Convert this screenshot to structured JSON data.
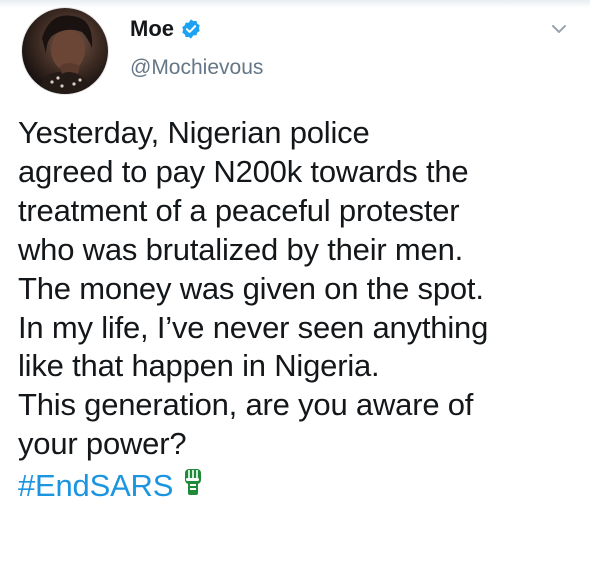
{
  "author": {
    "name": "Moe",
    "handle": "@Mochievous",
    "verified": true
  },
  "tweet": {
    "lines": [
      "Yesterday, Nigerian police",
      "agreed to pay N200k towards the",
      "treatment of a peaceful protester",
      "who was brutalized by their men.",
      "The money was given on the spot.",
      "In my life, I’ve never seen anything",
      "like that happen in Nigeria.",
      "This generation, are you aware of",
      "your power?"
    ],
    "hashtag": "#EndSARS",
    "hashtag_emoji": "raised-fist-green-emoji"
  },
  "icons": {
    "verified": "verified-badge-icon",
    "menu": "chevron-down-icon"
  },
  "colors": {
    "link": "#1b95e0",
    "verified": "#1da1f2",
    "text": "#14171a",
    "muted": "#657786"
  }
}
